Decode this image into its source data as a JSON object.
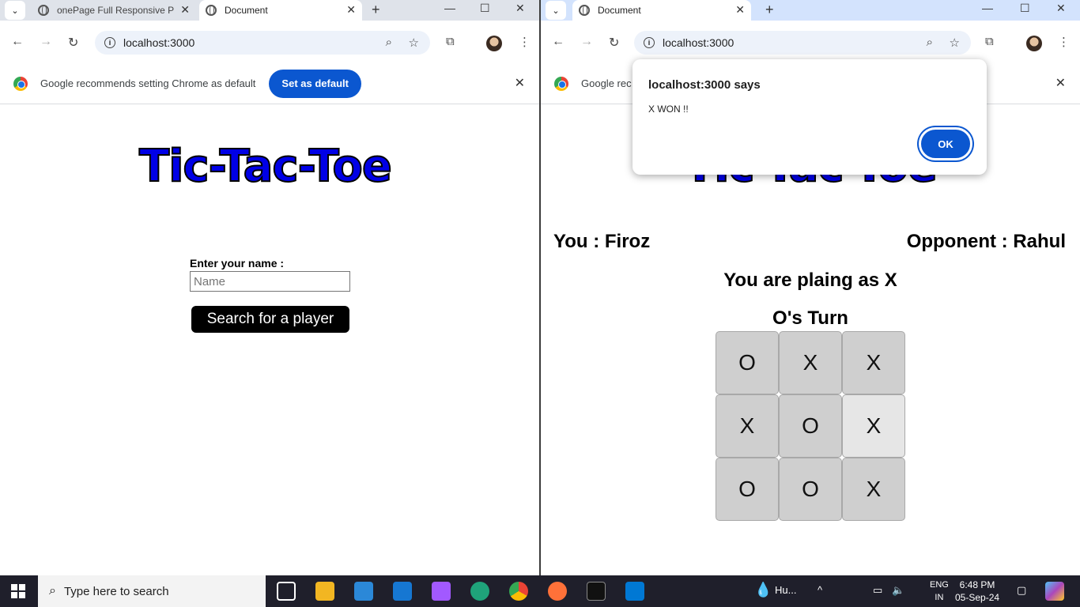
{
  "left_window": {
    "tabs": [
      {
        "label": "onePage Full Responsive P",
        "active": false
      },
      {
        "label": "Document",
        "active": true
      }
    ],
    "url": "localhost:3000",
    "infobar": {
      "text": "Google recommends setting Chrome as default",
      "button": "Set as default"
    },
    "page": {
      "title": "Tic-Tac-Toe",
      "name_label": "Enter your name :",
      "name_value": "",
      "name_placeholder": "Name",
      "search_button": "Search for a player"
    }
  },
  "right_window": {
    "tabs": [
      {
        "label": "Document",
        "active": true
      }
    ],
    "url": "localhost:3000",
    "infobar": {
      "text": "Google rec"
    },
    "page": {
      "title": "Tic-Tac-Toe",
      "you": "You : Firoz",
      "opponent": "Opponent : Rahul",
      "playing_as": "You are plaing as X",
      "turn": "O's Turn",
      "board": [
        "O",
        "X",
        "X",
        "X",
        "O",
        "X",
        "O",
        "O",
        "X"
      ],
      "highlighted_cell": 5
    },
    "dialog": {
      "title": "localhost:3000 says",
      "message": "X WON !!",
      "ok_button": "OK"
    }
  },
  "taskbar": {
    "search_placeholder": "Type here to search",
    "weather": "Hu...",
    "language": "ENG",
    "region": "IN",
    "time": "6:48 PM",
    "date": "05-Sep-24"
  },
  "colors": {
    "title_fill": "#0000e6",
    "accent_blue": "#0b57d0",
    "cell_bg": "#cfcfcf"
  }
}
